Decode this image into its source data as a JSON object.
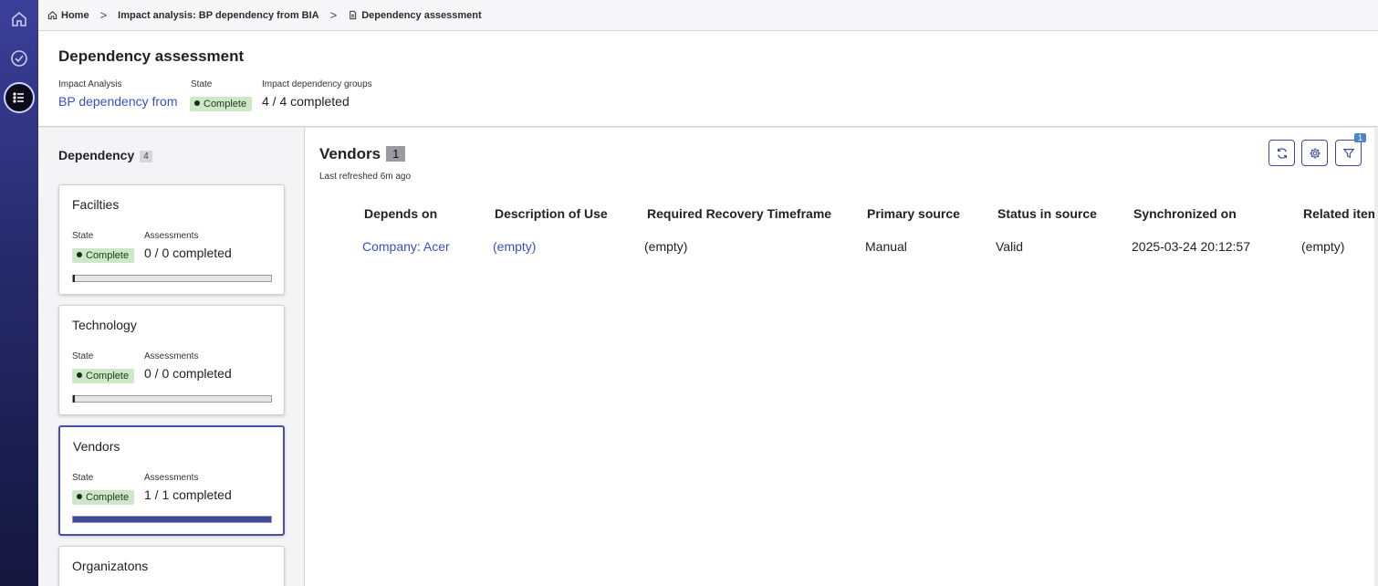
{
  "breadcrumb": {
    "home": "Home",
    "parent": "Impact analysis: BP dependency from BIA",
    "current": "Dependency assessment"
  },
  "header": {
    "title": "Dependency assessment",
    "impact_analysis_label": "Impact Analysis",
    "impact_analysis_value": "BP dependency from",
    "state_label": "State",
    "state_value": "Complete",
    "groups_label": "Impact dependency groups",
    "groups_value": "4 / 4 completed"
  },
  "left_panel": {
    "title": "Dependency",
    "count": "4",
    "cards": [
      {
        "name": "Facilties",
        "state_label": "State",
        "state": "Complete",
        "assess_label": "Assessments",
        "assessments": "0 / 0 completed",
        "progress": 0
      },
      {
        "name": "Technology",
        "state_label": "State",
        "state": "Complete",
        "assess_label": "Assessments",
        "assessments": "0 / 0 completed",
        "progress": 0
      },
      {
        "name": "Vendors",
        "state_label": "State",
        "state": "Complete",
        "assess_label": "Assessments",
        "assessments": "1 / 1 completed",
        "progress": 1.0
      },
      {
        "name": "Organizatons"
      }
    ]
  },
  "main": {
    "title": "Vendors",
    "count": "1",
    "refreshed": "Last refreshed 6m ago",
    "filter_count": "1",
    "columns": [
      "Depends on",
      "Description of Use",
      "Required Recovery Timeframe",
      "Primary source",
      "Status in source",
      "Synchronized on",
      "Related item"
    ],
    "rows": [
      [
        "Company: Acer",
        "(empty)",
        "(empty)",
        "Manual",
        "Valid",
        "2025-03-24 20:12:57",
        "(empty)"
      ]
    ]
  },
  "colors": {
    "accent": "#3e4a9c",
    "link": "#3a4fc7",
    "badge_bg": "#cde8c7"
  },
  "icons": {
    "rail": [
      "home-icon",
      "check-circle-icon",
      "list-icon"
    ],
    "toolbar": [
      "refresh-icon",
      "gear-icon",
      "filter-icon"
    ]
  }
}
